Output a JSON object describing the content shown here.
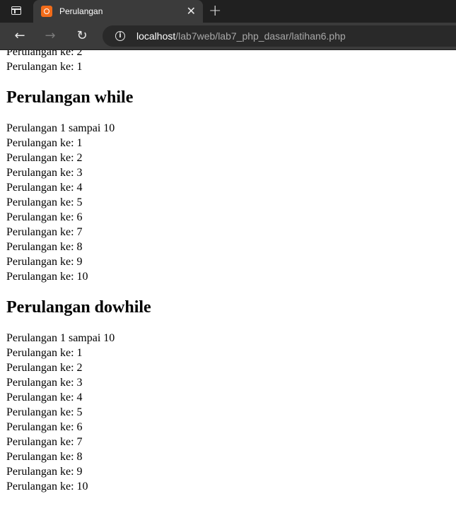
{
  "browser": {
    "tab_title": "Perulangan",
    "url_host": "localhost",
    "url_path": "/lab7web/lab7_php_dasar/latihan6.php"
  },
  "page": {
    "top_lines": [
      "Perulangan ke: 2",
      "Perulangan ke: 1"
    ],
    "sections": [
      {
        "heading": "Perulangan while",
        "intro": "Perulangan 1 sampai 10",
        "lines": [
          "Perulangan ke: 1",
          "Perulangan ke: 2",
          "Perulangan ke: 3",
          "Perulangan ke: 4",
          "Perulangan ke: 5",
          "Perulangan ke: 6",
          "Perulangan ke: 7",
          "Perulangan ke: 8",
          "Perulangan ke: 9",
          "Perulangan ke: 10"
        ]
      },
      {
        "heading": "Perulangan dowhile",
        "intro": "Perulangan 1 sampai 10",
        "lines": [
          "Perulangan ke: 1",
          "Perulangan ke: 2",
          "Perulangan ke: 3",
          "Perulangan ke: 4",
          "Perulangan ke: 5",
          "Perulangan ke: 6",
          "Perulangan ke: 7",
          "Perulangan ke: 8",
          "Perulangan ke: 9",
          "Perulangan ke: 10"
        ]
      }
    ]
  }
}
